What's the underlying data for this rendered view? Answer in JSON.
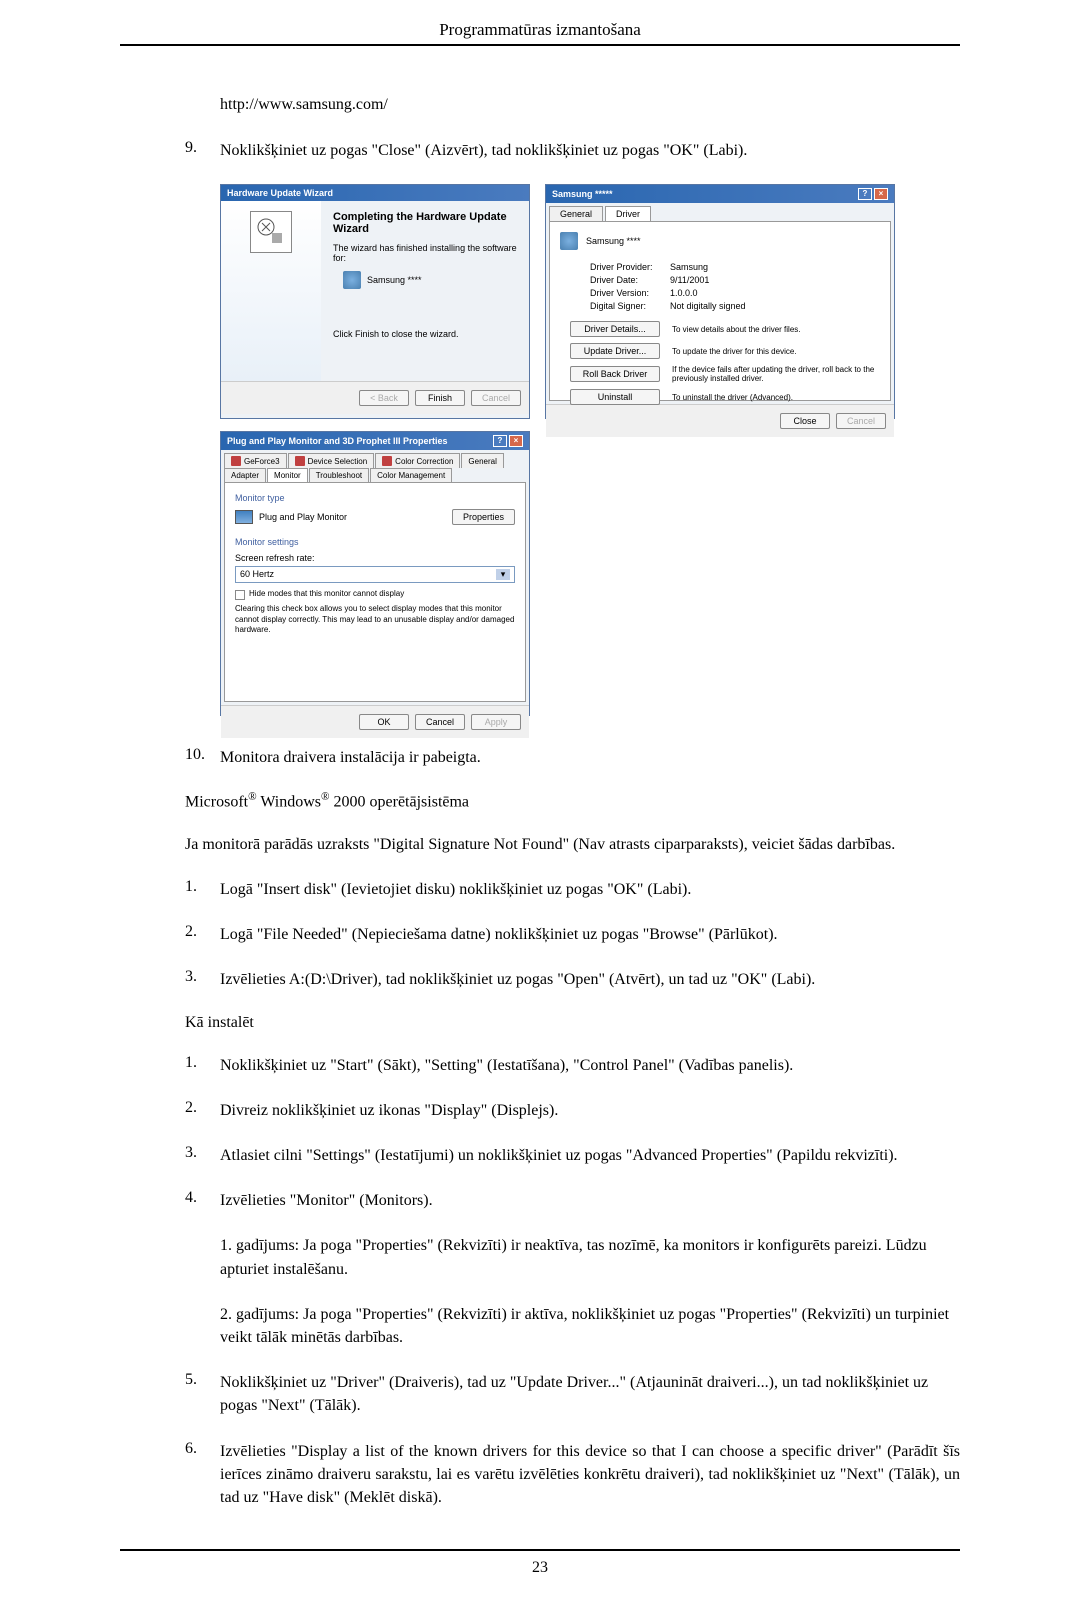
{
  "page_title": "Programmatūras izmantošana",
  "url": "http://www.samsung.com/",
  "step9": {
    "num": "9.",
    "text": "Noklikšķiniet uz pogas \"Close\" (Aizvērt), tad noklikšķiniet uz pogas \"OK\" (Labi)."
  },
  "wizard": {
    "title": "Hardware Update Wizard",
    "heading": "Completing the Hardware Update Wizard",
    "text1": "The wizard has finished installing the software for:",
    "device": "Samsung ****",
    "text2": "Click Finish to close the wizard.",
    "btn_back": "< Back",
    "btn_finish": "Finish",
    "btn_cancel": "Cancel"
  },
  "driver": {
    "title": "Samsung *****",
    "tab_general": "General",
    "tab_driver": "Driver",
    "device": "Samsung ****",
    "provider_label": "Driver Provider:",
    "provider_value": "Samsung",
    "date_label": "Driver Date:",
    "date_value": "9/11/2001",
    "version_label": "Driver Version:",
    "version_value": "1.0.0.0",
    "signer_label": "Digital Signer:",
    "signer_value": "Not digitally signed",
    "btn_details": "Driver Details...",
    "desc_details": "To view details about the driver files.",
    "btn_update": "Update Driver...",
    "desc_update": "To update the driver for this device.",
    "btn_rollback": "Roll Back Driver",
    "desc_rollback": "If the device fails after updating the driver, roll back to the previously installed driver.",
    "btn_uninstall": "Uninstall",
    "desc_uninstall": "To uninstall the driver (Advanced).",
    "btn_close": "Close",
    "btn_cancel": "Cancel"
  },
  "props": {
    "title": "Plug and Play Monitor and 3D Prophet III Properties",
    "tab_geforce": "GeForce3",
    "tab_device": "Device Selection",
    "tab_color_corr": "Color Correction",
    "tab_general": "General",
    "tab_adapter": "Adapter",
    "tab_monitor": "Monitor",
    "tab_trouble": "Troubleshoot",
    "tab_color_mgmt": "Color Management",
    "section_type": "Monitor type",
    "monitor_name": "Plug and Play Monitor",
    "btn_properties": "Properties",
    "section_settings": "Monitor settings",
    "refresh_label": "Screen refresh rate:",
    "refresh_value": "60 Hertz",
    "checkbox_label": "Hide modes that this monitor cannot display",
    "checkbox_help": "Clearing this check box allows you to select display modes that this monitor cannot display correctly. This may lead to an unusable display and/or damaged hardware.",
    "btn_ok": "OK",
    "btn_cancel": "Cancel",
    "btn_apply": "Apply"
  },
  "step10": {
    "num": "10.",
    "text": "Monitora draivera instalācija ir pabeigta."
  },
  "os_heading_prefix": "Microsoft",
  "os_heading_mid": " Windows",
  "os_heading_suffix": " 2000 operētājsistēma",
  "reg_mark": "®",
  "intro_para": "Ja monitorā parādās uzraksts \"Digital Signature Not Found\" (Nav atrasts ciparparaksts), veiciet šādas darbības.",
  "dsn_steps": [
    {
      "num": "1.",
      "text": "Logā \"Insert disk\" (Ievietojiet disku) noklikšķiniet uz pogas \"OK\" (Labi)."
    },
    {
      "num": "2.",
      "text": "Logā \"File Needed\" (Nepieciešama datne) noklikšķiniet uz pogas \"Browse\" (Pārlūkot)."
    },
    {
      "num": "3.",
      "text": "Izvēlieties A:(D:\\Driver), tad noklikšķiniet uz pogas \"Open\" (Atvērt), un tad uz \"OK\" (Labi)."
    }
  ],
  "how_install": "Kā instalēt",
  "install_steps": [
    {
      "num": "1.",
      "text": "Noklikšķiniet uz \"Start\" (Sākt), \"Setting\" (Iestatīšana), \"Control Panel\" (Vadības panelis)."
    },
    {
      "num": "2.",
      "text": "Divreiz noklikšķiniet uz ikonas \"Display\" (Displejs)."
    },
    {
      "num": "3.",
      "text": "Atlasiet cilni \"Settings\" (Iestatījumi) un noklikšķiniet uz pogas \"Advanced Properties\" (Papildu rekvizīti)."
    },
    {
      "num": "4.",
      "text": "Izvēlieties \"Monitor\" (Monitors)."
    }
  ],
  "case1": "1. gadījums: Ja poga \"Properties\" (Rekvizīti) ir neaktīva, tas nozīmē, ka monitors ir konfigurēts pareizi. Lūdzu apturiet instalēšanu.",
  "case2": "2. gadījums: Ja poga \"Properties\" (Rekvizīti) ir aktīva, noklikšķiniet uz pogas \"Properties\" (Rekvizīti) un turpiniet veikt tālāk minētās darbības.",
  "install_steps2": [
    {
      "num": "5.",
      "text": "Noklikšķiniet uz \"Driver\" (Draiveris), tad uz \"Update Driver...\" (Atjaunināt draiveri...), un tad noklikšķiniet uz pogas \"Next\" (Tālāk)."
    },
    {
      "num": "6.",
      "text": "Izvēlieties \"Display a list of the known drivers for this device so that I can choose a specific driver\" (Parādīt šīs ierīces zināmo draiveru sarakstu, lai es varētu izvēlēties konkrētu draiveri), tad noklikšķiniet uz \"Next\" (Tālāk), un tad uz \"Have disk\" (Meklēt diskā)."
    }
  ],
  "page_number": "23"
}
